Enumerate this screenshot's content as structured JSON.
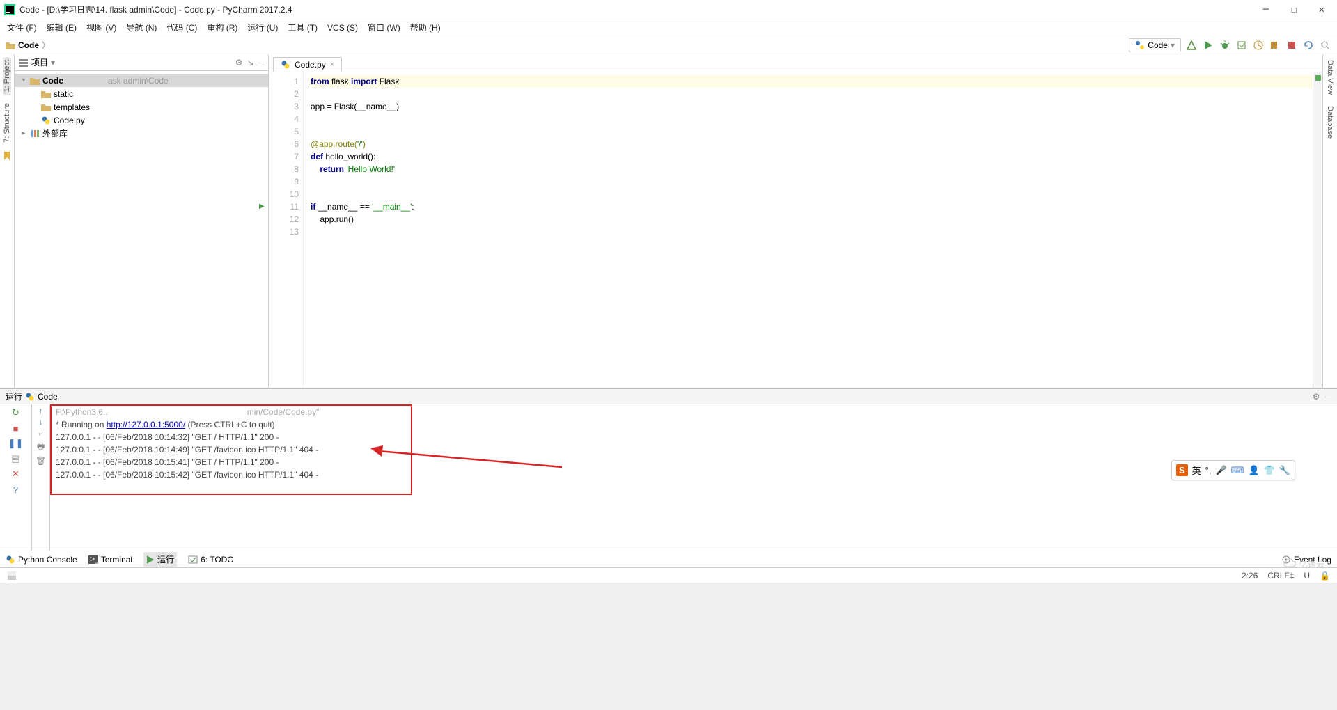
{
  "window": {
    "title": "Code - [D:\\学习日志\\14. flask admin\\Code] - Code.py - PyCharm 2017.2.4"
  },
  "menu": [
    "文件 (F)",
    "编辑 (E)",
    "视图 (V)",
    "导航 (N)",
    "代码 (C)",
    "重构 (R)",
    "运行 (U)",
    "工具 (T)",
    "VCS (S)",
    "窗口 (W)",
    "帮助 (H)"
  ],
  "breadcrumb": {
    "root": "Code"
  },
  "run_config": {
    "label": "Code"
  },
  "project_panel": {
    "title": "项目",
    "tree": {
      "root": "Code",
      "root_path": "ask admin\\Code",
      "children": [
        {
          "name": "static",
          "type": "folder"
        },
        {
          "name": "templates",
          "type": "folder"
        },
        {
          "name": "Code.py",
          "type": "pyfile"
        }
      ],
      "external": "外部库"
    }
  },
  "editor": {
    "tab": "Code.py",
    "lines": [
      {
        "n": 1,
        "kw1": "from ",
        "plain1": "flask ",
        "kw2": "import ",
        "plain2": "Flask",
        "hl": true
      },
      {
        "n": 2,
        "plain": ""
      },
      {
        "n": 3,
        "plain": "app = Flask(__name__)"
      },
      {
        "n": 4,
        "plain": ""
      },
      {
        "n": 5,
        "plain": ""
      },
      {
        "n": 6,
        "dec": "@app.route(",
        "str": "'/'",
        "dec2": ")"
      },
      {
        "n": 7,
        "kw": "def ",
        "plain": "hello_world():"
      },
      {
        "n": 8,
        "indent": "    ",
        "kw": "return ",
        "str": "'Hello World!'"
      },
      {
        "n": 9,
        "plain": ""
      },
      {
        "n": 10,
        "plain": ""
      },
      {
        "n": 11,
        "kw": "if ",
        "plain": "__name__ == ",
        "str": "'__main__'",
        "plain2": ":",
        "play": true
      },
      {
        "n": 12,
        "indent": "    ",
        "plain": "app.run()"
      },
      {
        "n": 13,
        "plain": ""
      }
    ]
  },
  "run_panel": {
    "header": "运行",
    "config": "Code",
    "console": {
      "first_line_left": "F:\\Python3.6..",
      "first_line_right": "min/Code/Code.py\"",
      "running_prefix": " * Running on ",
      "url": "http://127.0.0.1:5000/",
      "running_suffix": " (Press CTRL+C to quit)",
      "logs": [
        "127.0.0.1 - - [06/Feb/2018 10:14:32] \"GET / HTTP/1.1\" 200 -",
        "127.0.0.1 - - [06/Feb/2018 10:14:49] \"GET /favicon.ico HTTP/1.1\" 404 -",
        "127.0.0.1 - - [06/Feb/2018 10:15:41] \"GET / HTTP/1.1\" 200 -",
        "127.0.0.1 - - [06/Feb/2018 10:15:42] \"GET /favicon.ico HTTP/1.1\" 404 -"
      ]
    }
  },
  "bottom_tabs": {
    "python_console": "Python Console",
    "terminal": "Terminal",
    "run": "运行",
    "todo": "6: TODO",
    "event_log": "Event Log"
  },
  "left_tabs": [
    "1: Project",
    "7: Structure"
  ],
  "right_tabs": [
    "Data View",
    "Database"
  ],
  "status": {
    "pos": "2:26",
    "eol": "CRLF‡",
    "enc": "U"
  },
  "ime": {
    "logo": "S",
    "lang": "英"
  },
  "watermark": "亿速云"
}
